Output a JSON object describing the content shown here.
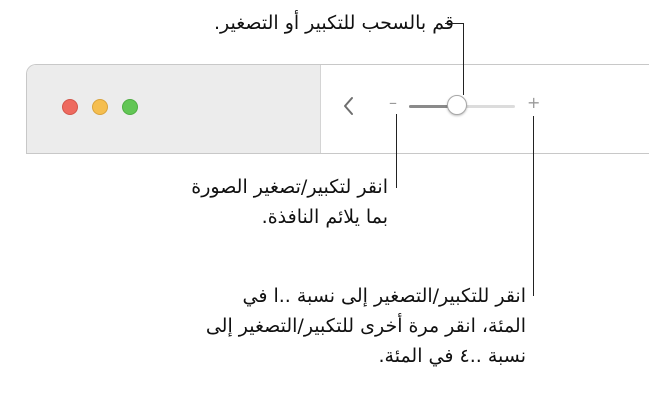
{
  "callouts": {
    "drag_slider": "قم بالسحب للتكبير أو التصغير.",
    "fit_window": [
      "انقر لتكبير/تصغير الصورة",
      "بما يلائم النافذة."
    ],
    "zoom_plus": [
      "انقر للتكبير/التصغير إلى نسبة ..ا في",
      "المئة، انقر مرة أخرى للتكبير/التصغير إلى",
      "نسبة ..٤ في المئة."
    ]
  },
  "toolbar": {
    "zoom_out_symbol": "–",
    "zoom_in_symbol": "+",
    "back_icon": "chevron-left-icon",
    "zoom_level_fraction": 0.45
  },
  "window_controls": {
    "close_color": "#ee6a5f",
    "minimize_color": "#f5be4f",
    "zoom_color": "#62c655"
  }
}
